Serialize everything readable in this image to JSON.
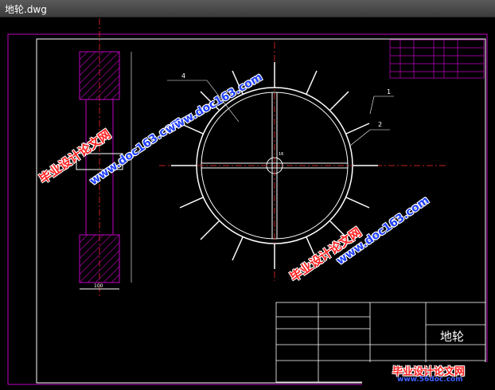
{
  "window": {
    "title": "地轮.dwg"
  },
  "drawing": {
    "title_block_name": "地轮",
    "part_labels": [
      "1",
      "2",
      "4"
    ],
    "dimensions": {
      "width_100": "100",
      "dim_16": "16"
    }
  },
  "watermarks": {
    "cn_text": "毕业设计论文网",
    "url_text": "www.doc163.com",
    "footer_cn": "毕业设计论文网",
    "footer_url": "www.56doc.com"
  },
  "colors": {
    "line": "#ffffff",
    "frame": "#c000c0",
    "hatch": "#c000c0",
    "center": "#c02020",
    "titlebar": "#4a4a4a"
  }
}
